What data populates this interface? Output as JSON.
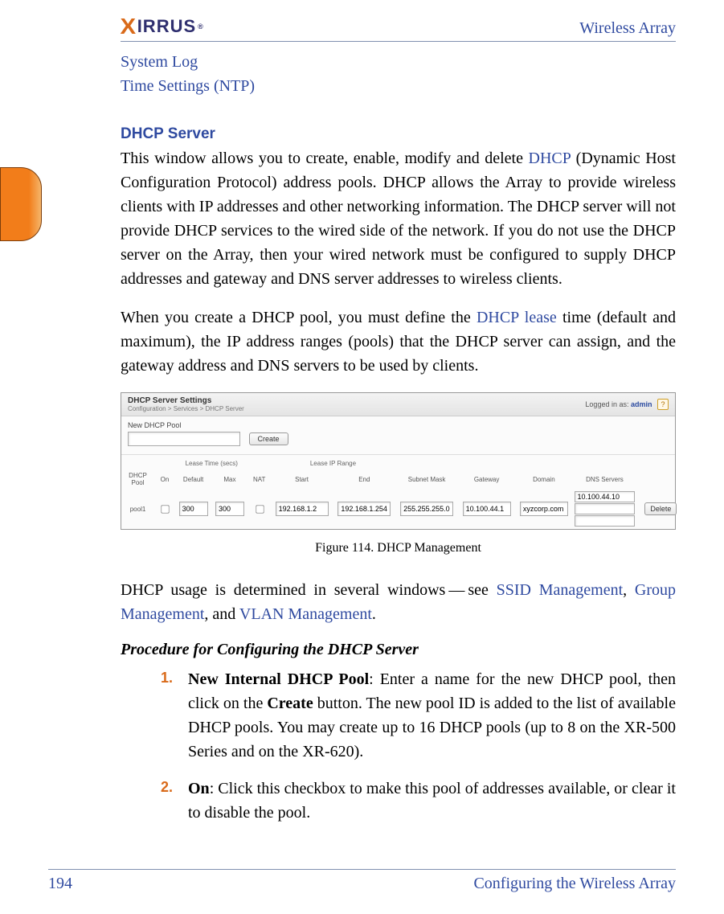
{
  "header": {
    "product": "Wireless Array",
    "logo_text": "IRRUS"
  },
  "linklist": {
    "item1": "System Log",
    "item2": "Time Settings (NTP)"
  },
  "section": {
    "title": "DHCP Server",
    "p1a": "This window allows you to create, enable, modify and delete ",
    "p1_link1": "DHCP",
    "p1b": " (Dynamic Host Configuration Protocol) address pools. DHCP allows the Array to provide wireless clients with IP addresses and other networking information. The DHCP server will not provide DHCP services to the wired side of the network. If you do not use the DHCP server on the Array, then your wired network must be configured to supply DHCP addresses and gateway and DNS server addresses to wireless clients.",
    "p2a": "When you create a DHCP pool, you must define the ",
    "p2_link1": "DHCP lease",
    "p2b": " time (default and maximum), the IP address ranges (pools) that the DHCP server can assign, and the gateway address and DNS servers to be used by clients."
  },
  "figure": {
    "settings_title": "DHCP Server Settings",
    "breadcrumb": "Configuration > Services > DHCP Server",
    "logged_prefix": "Logged in as: ",
    "logged_user": "admin",
    "new_pool_label": "New DHCP Pool",
    "create_btn": "Create",
    "sup_lease": "Lease Time (secs)",
    "sup_range": "Lease IP Range",
    "cols": {
      "pool": "DHCP Pool",
      "on": "On",
      "default": "Default",
      "max": "Max",
      "nat": "NAT",
      "start": "Start",
      "end": "End",
      "mask": "Subnet Mask",
      "gateway": "Gateway",
      "domain": "Domain",
      "dns": "DNS Servers"
    },
    "row": {
      "pool": "pool1",
      "default": "300",
      "max": "300",
      "start": "192.168.1.2",
      "end": "192.168.1.254",
      "mask": "255.255.255.0",
      "gateway": "10.100.44.1",
      "domain": "xyzcorp.com",
      "dns1": "10.100.44.10",
      "delete": "Delete"
    },
    "caption": "Figure 114. DHCP Management"
  },
  "para3": {
    "a": "DHCP usage is determined in several windows — see ",
    "link1": "SSID Management",
    "b": ", ",
    "link2": "Group Management",
    "c": ", and ",
    "link3": "VLAN Management",
    "d": "."
  },
  "procedure": {
    "heading": "Procedure for Configuring the DHCP Server",
    "step1_num": "1.",
    "step1_bold": "New Internal DHCP Pool",
    "step1_rest_a": ": Enter a name for the new DHCP pool, then click on the ",
    "step1_bold2": "Create",
    "step1_rest_b": " button. The new pool ID is added to the list of available DHCP pools. You may create up to 16 DHCP pools (up to 8 on the XR-500 Series and on the XR-620).",
    "step2_num": "2.",
    "step2_bold": "On",
    "step2_rest": ": Click this checkbox to make this pool of addresses available, or clear it to disable the pool."
  },
  "footer": {
    "page": "194",
    "section": "Configuring the Wireless Array"
  }
}
